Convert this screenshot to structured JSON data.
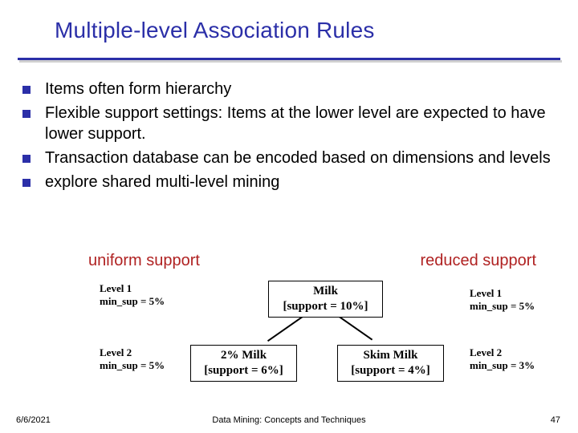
{
  "title": "Multiple-level Association Rules",
  "bullets": [
    "Items often form hierarchy",
    "Flexible support settings: Items at the lower level are expected to have lower support.",
    "Transaction database can be encoded based on dimensions and levels",
    "explore shared multi-level mining"
  ],
  "labels": {
    "uniform": "uniform support",
    "reduced": "reduced support"
  },
  "levels_left": {
    "l1_line1": "Level 1",
    "l1_line2": "min_sup = 5%",
    "l2_line1": "Level 2",
    "l2_line2": "min_sup = 5%"
  },
  "levels_right": {
    "l1_line1": "Level 1",
    "l1_line2": "min_sup = 5%",
    "l2_line1": "Level 2",
    "l2_line2": "min_sup = 3%"
  },
  "nodes": {
    "milk_line1": "Milk",
    "milk_line2": "[support = 10%]",
    "twopct_line1": "2% Milk",
    "twopct_line2": "[support = 6%]",
    "skim_line1": "Skim Milk",
    "skim_line2": "[support = 4%]"
  },
  "footer": {
    "date": "6/6/2021",
    "center": "Data Mining: Concepts and Techniques",
    "page": "47"
  },
  "chart_data": {
    "type": "tree",
    "nodes": [
      {
        "id": "milk",
        "label": "Milk",
        "support_pct": 10,
        "level": 1
      },
      {
        "id": "two_pct_milk",
        "label": "2% Milk",
        "support_pct": 6,
        "level": 2,
        "parent": "milk"
      },
      {
        "id": "skim_milk",
        "label": "Skim Milk",
        "support_pct": 4,
        "level": 2,
        "parent": "milk"
      }
    ],
    "min_support": {
      "uniform": {
        "level1_pct": 5,
        "level2_pct": 5
      },
      "reduced": {
        "level1_pct": 5,
        "level2_pct": 3
      }
    }
  }
}
